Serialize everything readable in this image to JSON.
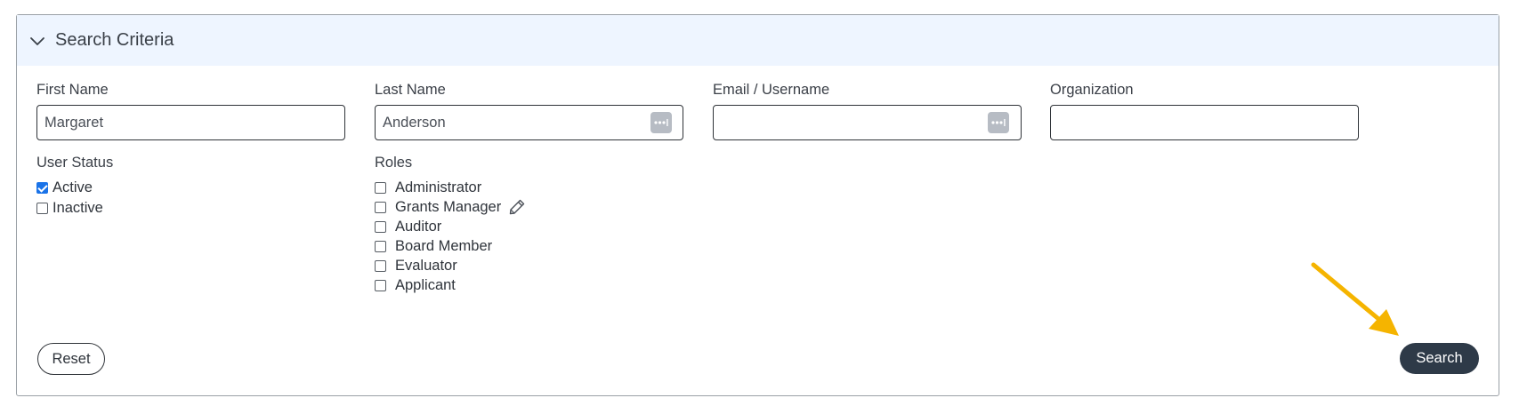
{
  "header": {
    "title": "Search Criteria",
    "icon": "chevron-down-icon"
  },
  "fields": {
    "first_name": {
      "label": "First Name",
      "value": "Margaret",
      "placeholder": ""
    },
    "last_name": {
      "label": "Last Name",
      "value": "Anderson",
      "placeholder": ""
    },
    "email": {
      "label": "Email / Username",
      "value": "",
      "placeholder": ""
    },
    "organization": {
      "label": "Organization",
      "value": "",
      "placeholder": ""
    }
  },
  "user_status": {
    "label": "User Status",
    "options": [
      {
        "label": "Active",
        "checked": true
      },
      {
        "label": "Inactive",
        "checked": false
      }
    ]
  },
  "roles": {
    "label": "Roles",
    "options": [
      {
        "label": "Administrator",
        "checked": false
      },
      {
        "label": "Grants Manager",
        "checked": false
      },
      {
        "label": "Auditor",
        "checked": false
      },
      {
        "label": "Board Member",
        "checked": false
      },
      {
        "label": "Evaluator",
        "checked": false
      },
      {
        "label": "Applicant",
        "checked": false
      }
    ]
  },
  "buttons": {
    "reset": "Reset",
    "search": "Search"
  },
  "colors": {
    "header_bg": "#eef5ff",
    "primary_button": "#2e3a48",
    "checkbox_checked": "#1a73e8",
    "annotation_arrow": "#f5b400"
  }
}
